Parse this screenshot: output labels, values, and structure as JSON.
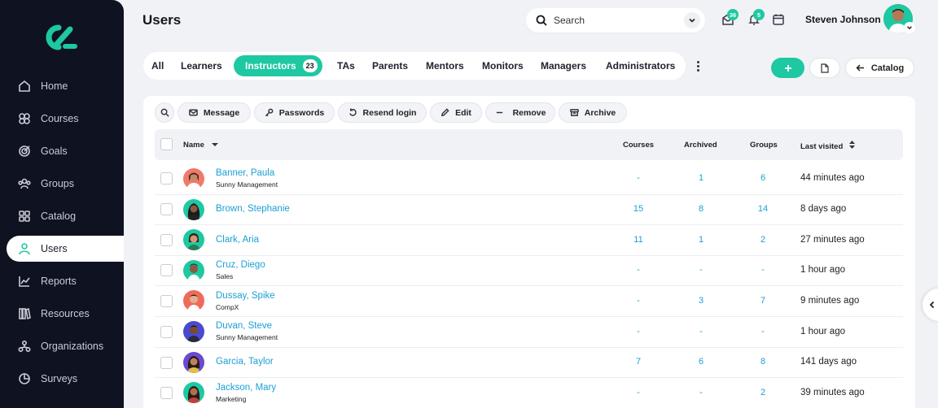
{
  "sidebar": {
    "items": [
      {
        "label": "Home",
        "icon": "home-icon"
      },
      {
        "label": "Courses",
        "icon": "courses-icon"
      },
      {
        "label": "Goals",
        "icon": "goals-icon"
      },
      {
        "label": "Groups",
        "icon": "groups-icon"
      },
      {
        "label": "Catalog",
        "icon": "catalog-icon"
      },
      {
        "label": "Users",
        "icon": "users-icon",
        "active": true
      },
      {
        "label": "Reports",
        "icon": "reports-icon"
      },
      {
        "label": "Resources",
        "icon": "resources-icon"
      },
      {
        "label": "Organizations",
        "icon": "organizations-icon"
      },
      {
        "label": "Surveys",
        "icon": "surveys-icon"
      }
    ]
  },
  "header": {
    "title": "Users",
    "search_placeholder": "Search",
    "messages_count": "36",
    "notifications_count": "5",
    "user_name": "Steven Johnson"
  },
  "tabs": {
    "items": [
      "All",
      "Learners",
      "Instructors",
      "TAs",
      "Parents",
      "Mentors",
      "Monitors",
      "Managers",
      "Administrators"
    ],
    "active": "Instructors",
    "active_count": "23"
  },
  "toolbar": {
    "add_label": "+",
    "catalog_label": "Catalog"
  },
  "actions": [
    "Message",
    "Passwords",
    "Resend login",
    "Edit",
    "Remove",
    "Archive"
  ],
  "table": {
    "columns": {
      "name": "Name",
      "courses": "Courses",
      "archived": "Archived",
      "groups": "Groups",
      "last_visited": "Last visited"
    },
    "rows": [
      {
        "name": "Banner, Paula",
        "org": "Sunny Management",
        "courses": "-",
        "archived": "1",
        "groups": "6",
        "last": "44 minutes ago"
      },
      {
        "name": "Brown, Stephanie",
        "org": "",
        "courses": "15",
        "archived": "8",
        "groups": "14",
        "last": "8 days ago"
      },
      {
        "name": "Clark, Aria",
        "org": "",
        "courses": "11",
        "archived": "1",
        "groups": "2",
        "last": "27 minutes ago"
      },
      {
        "name": "Cruz, Diego",
        "org": "Sales",
        "courses": "-",
        "archived": "-",
        "groups": "-",
        "last": "1 hour ago"
      },
      {
        "name": "Dussay, Spike",
        "org": "CompX",
        "courses": "-",
        "archived": "3",
        "groups": "7",
        "last": "9 minutes ago"
      },
      {
        "name": "Duvan, Steve",
        "org": "Sunny Management",
        "courses": "-",
        "archived": "-",
        "groups": "-",
        "last": "1 hour ago"
      },
      {
        "name": "Garcia, Taylor",
        "org": "",
        "courses": "7",
        "archived": "6",
        "groups": "8",
        "last": "141 days ago"
      },
      {
        "name": "Jackson, Mary",
        "org": "Marketing",
        "courses": "-",
        "archived": "-",
        "groups": "2",
        "last": "39 minutes ago"
      }
    ]
  },
  "colors": {
    "accent": "#1ec8a2",
    "link": "#1b9fd4",
    "sidebar": "#0f1221"
  }
}
